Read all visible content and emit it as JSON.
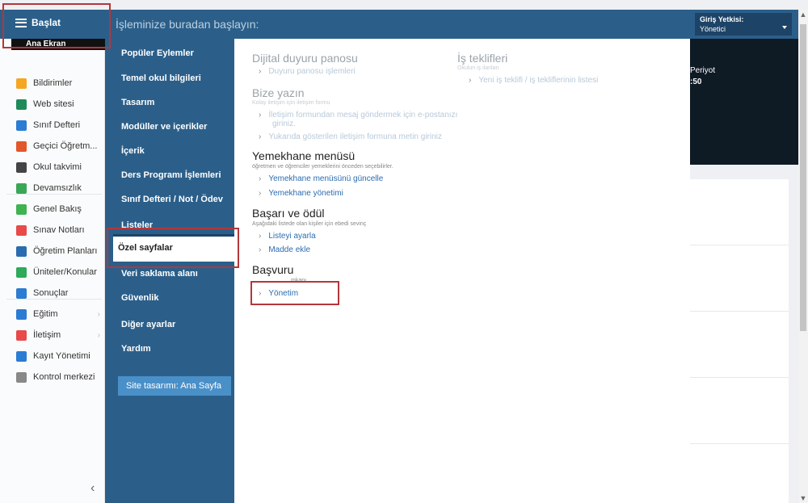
{
  "topbar": {
    "start_label": "Başlat",
    "title": "İşleminize buradan başlayın:",
    "auth_label": "Giriş Yetkisi:",
    "auth_value": "Yönetici"
  },
  "sidebar": {
    "top_item": "Ana Ekran",
    "items": [
      {
        "label": "Bildirimler",
        "icon": "envelope-icon",
        "color": "#f5a623"
      },
      {
        "label": "Web sitesi",
        "icon": "home-icon",
        "color": "#1e8a5a"
      },
      {
        "label": "Sınıf Defteri",
        "icon": "notebook-icon",
        "color": "#2b7cd3"
      },
      {
        "label": "Geçici Öğretm...",
        "icon": "person-icon",
        "color": "#e2582b"
      },
      {
        "label": "Okul takvimi",
        "icon": "calendar-icon",
        "color": "#444"
      },
      {
        "label": "Devamsızlık",
        "icon": "user-outline-icon",
        "color": "#3aa757"
      },
      {
        "label": "Genel Bakış",
        "icon": "check-circle-icon",
        "color": "#3fb34f"
      },
      {
        "label": "Sınav Notları",
        "icon": "grade-icon",
        "color": "#e84a4a"
      },
      {
        "label": "Öğretim Planları",
        "icon": "plan-icon",
        "color": "#2b6cb0"
      },
      {
        "label": "Üniteler/Konular",
        "icon": "shield-icon",
        "color": "#2eaa5a"
      },
      {
        "label": "Sonuçlar",
        "icon": "bar-chart-icon",
        "color": "#2b7cd3"
      },
      {
        "label": "Eğitim",
        "icon": "education-icon",
        "color": "#2b7cd3"
      },
      {
        "label": "İletişim",
        "icon": "chat-icon",
        "color": "#e84a4a"
      },
      {
        "label": "Kayıt Yönetimi",
        "icon": "pencil-icon",
        "color": "#2b7cd3"
      },
      {
        "label": "Kontrol merkezi",
        "icon": "gear-icon",
        "color": "#888"
      }
    ]
  },
  "menu": {
    "items": [
      "Popüler Eylemler",
      "Temel okul bilgileri",
      "Tasarım",
      "Modüller ve içerikler",
      "İçerik",
      "Ders Programı İşlemleri",
      "Sınıf Defteri / Not / Ödev",
      "Listeler",
      "Özel sayfalar",
      "Veri saklama alanı",
      "Güvenlik",
      "Diğer ayarlar",
      "Yardım"
    ],
    "site_button": "Site tasarımı: Ana Sayfa"
  },
  "flyout": {
    "dijital": {
      "title": "Dijital duyuru panosu",
      "link": "Duyuru panosu işlemleri"
    },
    "bize": {
      "title": "Bize yazın",
      "sub": "Kolay iletişim için iletişim formu",
      "link1": "İletişim formundan mesaj göndermek için e-postanızı",
      "link1b": "giriniz.",
      "link2": "Yukarıda gösterilen iletişim formuna metin giriniz"
    },
    "yemek": {
      "title": "Yemekhane menüsü",
      "sub": "öğretmen ve öğrenciler yemeklerini önceden seçebilirler.",
      "link1": "Yemekhane menüsünü güncelle",
      "link2": "Yemekhane yönetimi"
    },
    "basari": {
      "title": "Başarı ve ödül",
      "sub": "Aşağıdaki listede olan kişiler için ebedi sevinç",
      "link1": "Listeyi ayarla",
      "link2": "Madde ekle"
    },
    "basvuru": {
      "title": "Başvuru",
      "sub": "mkanı",
      "link": "Yönetim"
    },
    "is": {
      "title": "İş teklifleri",
      "sub": "Okulun iş ilanları",
      "link": "Yeni iş teklifi / iş tekliflerinin listesi"
    }
  },
  "right": {
    "periyot": "Periyot",
    "time": ":50"
  }
}
